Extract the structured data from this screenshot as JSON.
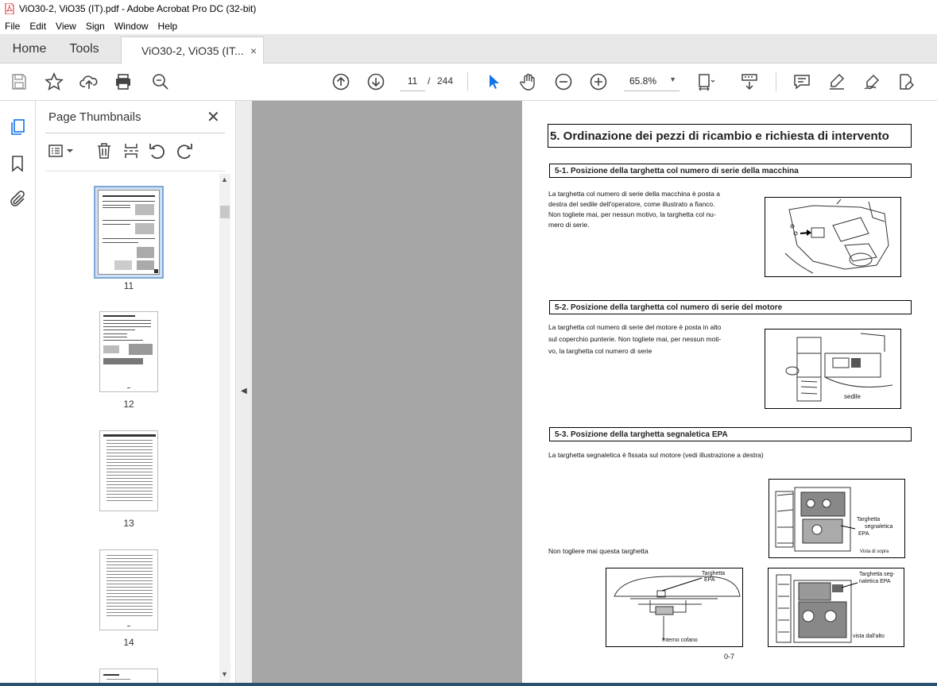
{
  "window": {
    "title": "ViO30-2, ViO35 (IT).pdf - Adobe Acrobat Pro DC (32-bit)"
  },
  "menu": [
    "File",
    "Edit",
    "View",
    "Sign",
    "Window",
    "Help"
  ],
  "tabs": {
    "home": "Home",
    "tools": "Tools",
    "document": "ViO30-2, ViO35 (IT...",
    "close_glyph": "×"
  },
  "toolbar": {
    "current_page": "11",
    "page_sep": "/",
    "total_pages": "244",
    "zoom": "65.8%",
    "icons": [
      "save-icon",
      "bookmark-star-icon",
      "upload-icon",
      "print-icon",
      "zoom-search-icon",
      "page-up-icon",
      "page-down-icon",
      "select-arrow-icon",
      "hand-icon",
      "zoom-out-icon",
      "zoom-in-icon",
      "fit-page-icon",
      "scroll-mode-icon",
      "comment-icon",
      "highlight-icon",
      "sign-icon",
      "edit-pdf-icon"
    ]
  },
  "panel": {
    "title": "Page Thumbnails",
    "close_glyph": "✕",
    "thumbnails": [
      {
        "label": "11",
        "selected": true
      },
      {
        "label": "12",
        "selected": false
      },
      {
        "label": "13",
        "selected": false
      },
      {
        "label": "14",
        "selected": false
      }
    ]
  },
  "document": {
    "heading": "5. Ordinazione dei pezzi di ricambio e richiesta di intervento",
    "section1": {
      "title": "5-1. Posizione della targhetta col numero di serie della macchina",
      "lines": [
        "La targhetta col numero di serie della macchina è posta a",
        "destra del sedile dell'operatore, come illustrato a fianco.",
        "Non togliete mai, per nessun motivo,  la targhetta col nu-",
        "mero di serie."
      ]
    },
    "section2": {
      "title": "5-2. Posizione della targhetta col numero di serie del motore",
      "lines": [
        "La targhetta col numero di serie del motore è posta in alto",
        "sul coperchio punterie. Non togliete mai, per nessun moti-",
        "vo,  la targhetta col numero di serie"
      ],
      "figure_label": "sedile"
    },
    "section3": {
      "title": "5-3. Posizione della targhetta segnaletica EPA",
      "text": "La targhetta segnaletica è fissata sul motore (vedi illustrazione a destra)",
      "warning": "Non togliere mai questa targhetta",
      "fig_top_right": {
        "label1": "Targhetta",
        "label2": "segnaletica",
        "label3": "EPA",
        "caption": "Vista di sopra"
      },
      "fig_bottom_left": {
        "label1": "Targhetta",
        "label2": "EPA",
        "caption": "Interno cofano"
      },
      "fig_bottom_right": {
        "label1": "Targhetta  seg-",
        "label2": "naletica EPA",
        "caption": "vista dall'alto"
      }
    },
    "page_number": "0-7"
  }
}
